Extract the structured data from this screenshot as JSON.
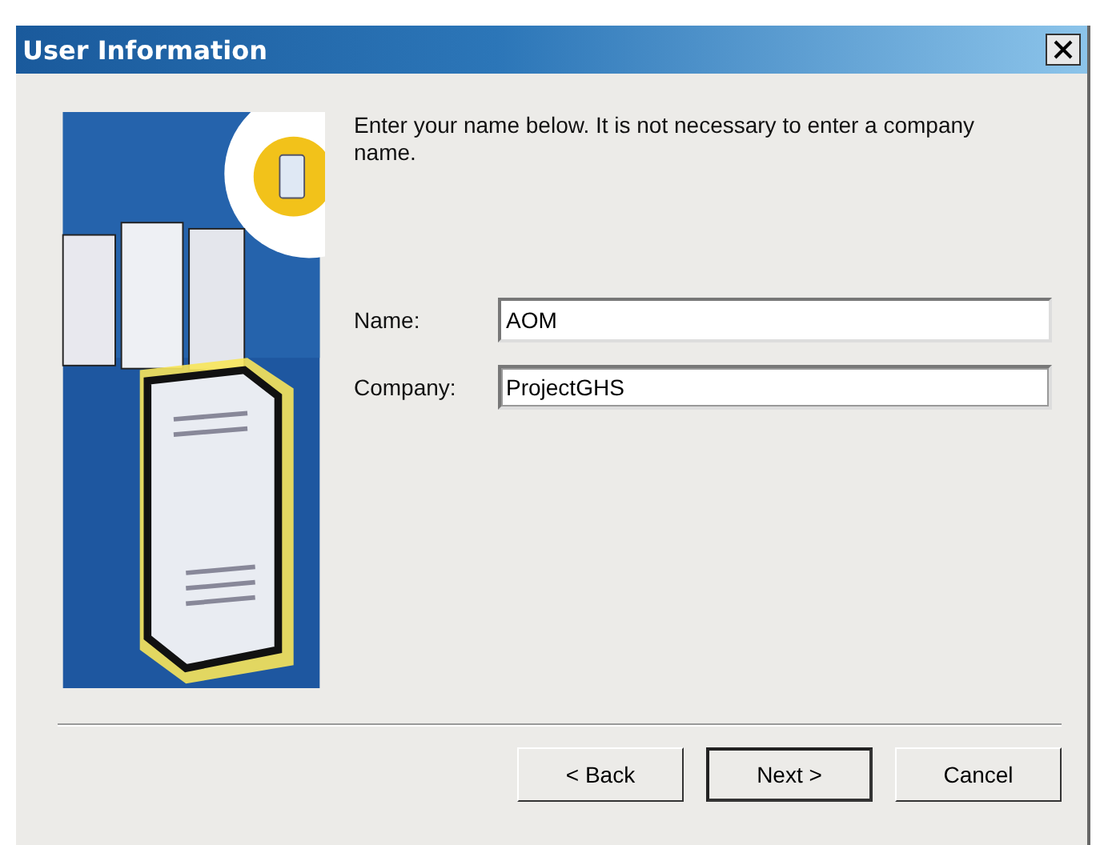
{
  "window": {
    "title": "User Information"
  },
  "instructions": "Enter your name below.  It is not necessary to enter a company name.",
  "fields": [
    {
      "label": "Name:",
      "value": "AOM",
      "focused": false
    },
    {
      "label": "Company:",
      "value": "ProjectGHS",
      "focused": true
    }
  ],
  "buttons": [
    {
      "label": "< Back",
      "default": false
    },
    {
      "label": "Next >",
      "default": true
    },
    {
      "label": "Cancel",
      "default": false
    }
  ]
}
